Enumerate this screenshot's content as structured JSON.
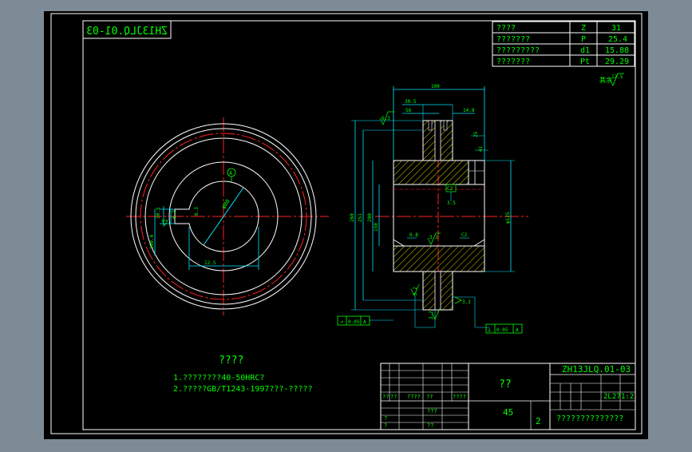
{
  "colors": {
    "background": "#000000",
    "frame": "#ffffff",
    "border_cyan": "#00d4e8",
    "text_green": "#00ff00",
    "center_red": "#ff2020",
    "hatch_yellow": "#e6e600",
    "dim_cyan": "#00e5ff",
    "tint_gray": "#7d8b96"
  },
  "drawing_number_mirrored": "ZH13JLQ.01-03",
  "param_table": {
    "rows": [
      {
        "name": "????",
        "symbol": "Z",
        "value": "31"
      },
      {
        "name": "???????",
        "symbol": "P",
        "value": "25.4"
      },
      {
        "name": "?????????",
        "symbol": "d1",
        "value": "15.88"
      },
      {
        "name": "???????",
        "symbol": "Pt",
        "value": "29.29"
      }
    ]
  },
  "roughness_note": "其余",
  "roughness_value": "12.5",
  "notes": {
    "heading": "????",
    "lines": [
      "1.????????40-50HRC?",
      "2.?????GB/T1243-1997???-?????"
    ]
  },
  "title_block": {
    "drawing_number": "ZH13JLQ.01-03",
    "part_name": "??",
    "material": "45",
    "quantity": "2",
    "scale": "1:2",
    "weight": "2L27",
    "school": "??????????????",
    "small_cells": [
      "??",
      "??",
      "????",
      "??",
      "???",
      "?",
      "?",
      "??"
    ]
  },
  "dimensions": {
    "overall_width": "100",
    "hub_left": "30.5",
    "hub_inner": "56",
    "hub_right": "14.8",
    "groove": "25",
    "ring_right": "41",
    "dia_1": "260",
    "dia_2": "251",
    "dia_3": "200",
    "dia_4": "150",
    "bore": "φ80",
    "bore_right": "φ125",
    "keyway_w": "10.5",
    "keyway_h": "6.2",
    "keyway_left": "160.4",
    "chamfer_left": "C2",
    "chamfer_right": "C2",
    "face_ra": "3.2",
    "ra_1": "6.3",
    "ra_2": "3.2",
    "runout": "0.05",
    "runout_datum": "A",
    "flat": "0.05",
    "flat_datum": "A",
    "key_dim": "3.5",
    "datum_a": "A",
    "side_val": "6.3",
    "bottom_val": "12.5",
    "section_dims": [
      "6.8",
      "3.2",
      "3.2"
    ]
  }
}
